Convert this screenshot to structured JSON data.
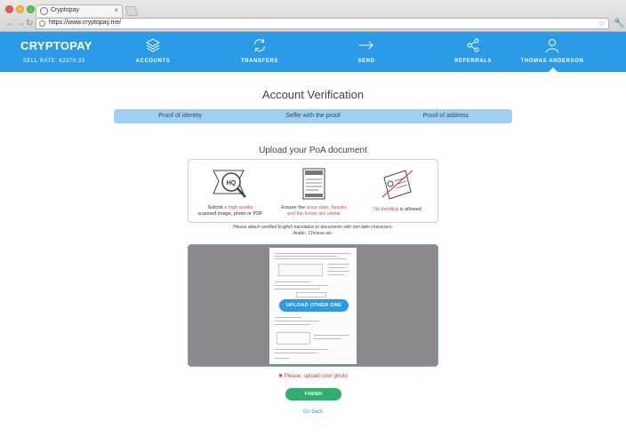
{
  "browser": {
    "tab_title": "Cryptopay",
    "url": "https://www.cryptopay.me/"
  },
  "header": {
    "brand": "CRYPTOPAY",
    "sell_rate": "SELL RATE: €2370.33",
    "nav": [
      {
        "label": "ACCOUNTS",
        "icon": "layers-icon"
      },
      {
        "label": "TRANSFERS",
        "icon": "refresh-icon"
      },
      {
        "label": "SEND",
        "icon": "arrow-right-icon"
      },
      {
        "label": "REFERRALS",
        "icon": "share-icon"
      },
      {
        "label": "THOMAS ANDERSON",
        "icon": "user-icon"
      }
    ],
    "accent_color": "#2b9be8"
  },
  "page": {
    "title": "Account Verification",
    "steps": [
      "Proof of identity",
      "Selfie with the proof",
      "Proof of address"
    ],
    "subtitle": "Upload your PoA document"
  },
  "guide": {
    "col1_a": "Submit ",
    "col1_hl": "a high quality",
    "col1_b": "scanned image, photo or PDF",
    "col2_a": "Ensure the ",
    "col2_hl1": "issue date, header",
    "col2_hl2": "and the footer are visible",
    "col3_hl": "No bending",
    "col3_b": " is allowed",
    "hq_badge": "HQ"
  },
  "note": {
    "line1": "Please attach certified English translation to documents with non-latin characters:",
    "line2": "Arabic, Chinese etc."
  },
  "upload": {
    "button_label": "UPLOAD OTHER ONE"
  },
  "error": {
    "icon": "✖",
    "text": "Please, upload color photo"
  },
  "actions": {
    "finish_label": "FINISH",
    "back_label": "Go back"
  }
}
